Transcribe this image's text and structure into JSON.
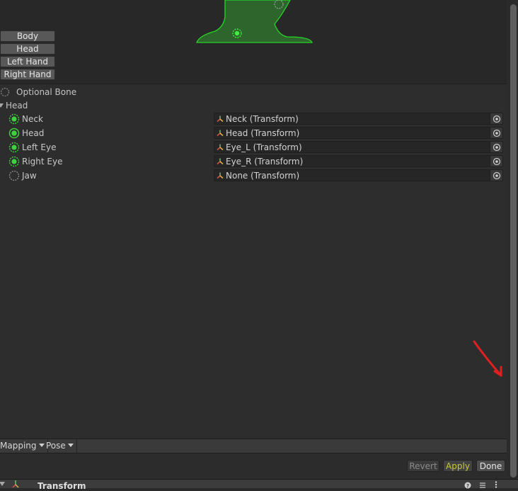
{
  "body_parts": [
    "Body",
    "Head",
    "Left Hand",
    "Right Hand"
  ],
  "legend": {
    "optional_bone": "Optional Bone"
  },
  "section": {
    "title": "Head"
  },
  "bones": [
    {
      "label": "Neck",
      "value": "Neck (Transform)",
      "icon": "bone-dashed-filled-green"
    },
    {
      "label": "Head",
      "value": "Head (Transform)",
      "icon": "bone-solid-filled-green"
    },
    {
      "label": "Left Eye",
      "value": "Eye_L (Transform)",
      "icon": "bone-dashed-filled-green"
    },
    {
      "label": "Right Eye",
      "value": "Eye_R (Transform)",
      "icon": "bone-dashed-filled-green"
    },
    {
      "label": "Jaw",
      "value": "None (Transform)",
      "icon": "bone-dashed-empty-gray"
    }
  ],
  "toolbar": {
    "mapping_label": "Mapping",
    "pose_label": "Pose"
  },
  "actions": {
    "revert_label": "Revert",
    "apply_label": "Apply",
    "done_label": "Done"
  },
  "component": {
    "title": "Transform"
  },
  "colors": {
    "accent_green": "#3ed23e",
    "apply_text": "#c8c838",
    "annotation_red": "#e02020"
  }
}
